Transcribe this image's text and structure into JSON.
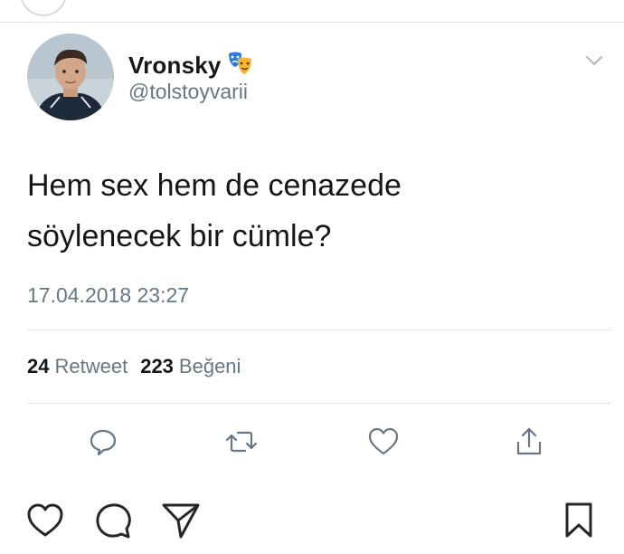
{
  "tweet": {
    "display_name": "Vronsky",
    "display_name_emoji": "performing-arts-masks-icon",
    "handle": "@tolstoyvarii",
    "text_lines": [
      "Hem sex hem de cenazede",
      "söylenecek bir cümle?"
    ],
    "timestamp": "17.04.2018 23:27",
    "retweets": "24",
    "retweets_label": "Retweet",
    "likes": "223",
    "likes_label": "Beğeni"
  },
  "colors": {
    "text_primary": "#14171a",
    "text_secondary": "#657786",
    "divider": "#dfe3e6",
    "icon_gray": "#657786",
    "ig_icon": "#262626"
  },
  "tweet_actions": [
    "reply-icon",
    "retweet-icon",
    "like-icon",
    "share-icon"
  ],
  "instagram_actions": [
    "heart-icon",
    "comment-icon",
    "send-icon",
    "bookmark-icon"
  ]
}
